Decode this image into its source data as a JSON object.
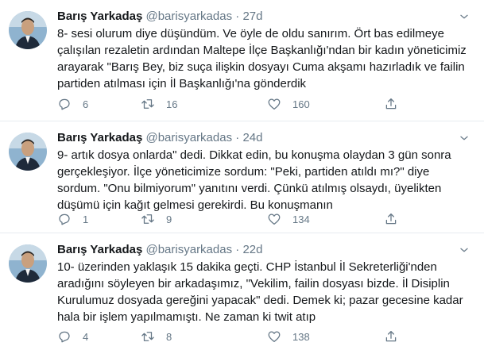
{
  "colors": {
    "text_primary": "#14171a",
    "text_secondary": "#657786",
    "divider": "#e6ecf0"
  },
  "icons": {
    "reply": "reply-icon",
    "retweet": "retweet-icon",
    "like": "like-icon",
    "share": "share-icon",
    "caret": "chevron-down-icon"
  },
  "tweets": [
    {
      "name": "Barış Yarkadaş",
      "handle": "@barisyarkadas",
      "separator": "·",
      "time": "27d",
      "text": "8- sesi olurum diye düşündüm. Ve öyle de oldu sanırım. Ört bas edilmeye çalışılan rezaletin ardından Maltepe İlçe Başkanlığı'ndan bir kadın yöneticimiz arayarak \"Barış Bey, biz suça ilişkin dosyayı Cuma akşamı hazırladık ve failin partiden atılması için İl Başkanlığı'na gönderdik",
      "replies": "6",
      "retweets": "16",
      "likes": "160"
    },
    {
      "name": "Barış Yarkadaş",
      "handle": "@barisyarkadas",
      "separator": "·",
      "time": "24d",
      "text": "9- artık dosya onlarda\" dedi. Dikkat edin, bu konuşma olaydan 3 gün sonra gerçekleşiyor. İlçe yöneticimize sordum: \"Peki, partiden atıldı mı?\" diye sordum. \"Onu bilmiyorum\" yanıtını verdi. Çünkü atılmış olsaydı, üyelikten düşümü için kağıt gelmesi gerekirdi. Bu konuşmanın",
      "replies": "1",
      "retweets": "9",
      "likes": "134"
    },
    {
      "name": "Barış Yarkadaş",
      "handle": "@barisyarkadas",
      "separator": "·",
      "time": "22d",
      "text": "10- üzerinden yaklaşık 15 dakika geçti. CHP İstanbul İl Sekreterliği'nden aradığını söyleyen bir arkadaşımız, \"Vekilim, failin dosyası bizde. İl Disiplin Kurulumuz dosyada gereğini yapacak\" dedi. Demek ki; pazar gecesine kadar hala bir işlem yapılmamıştı. Ne zaman ki twit atıp",
      "replies": "4",
      "retweets": "8",
      "likes": "138"
    }
  ]
}
